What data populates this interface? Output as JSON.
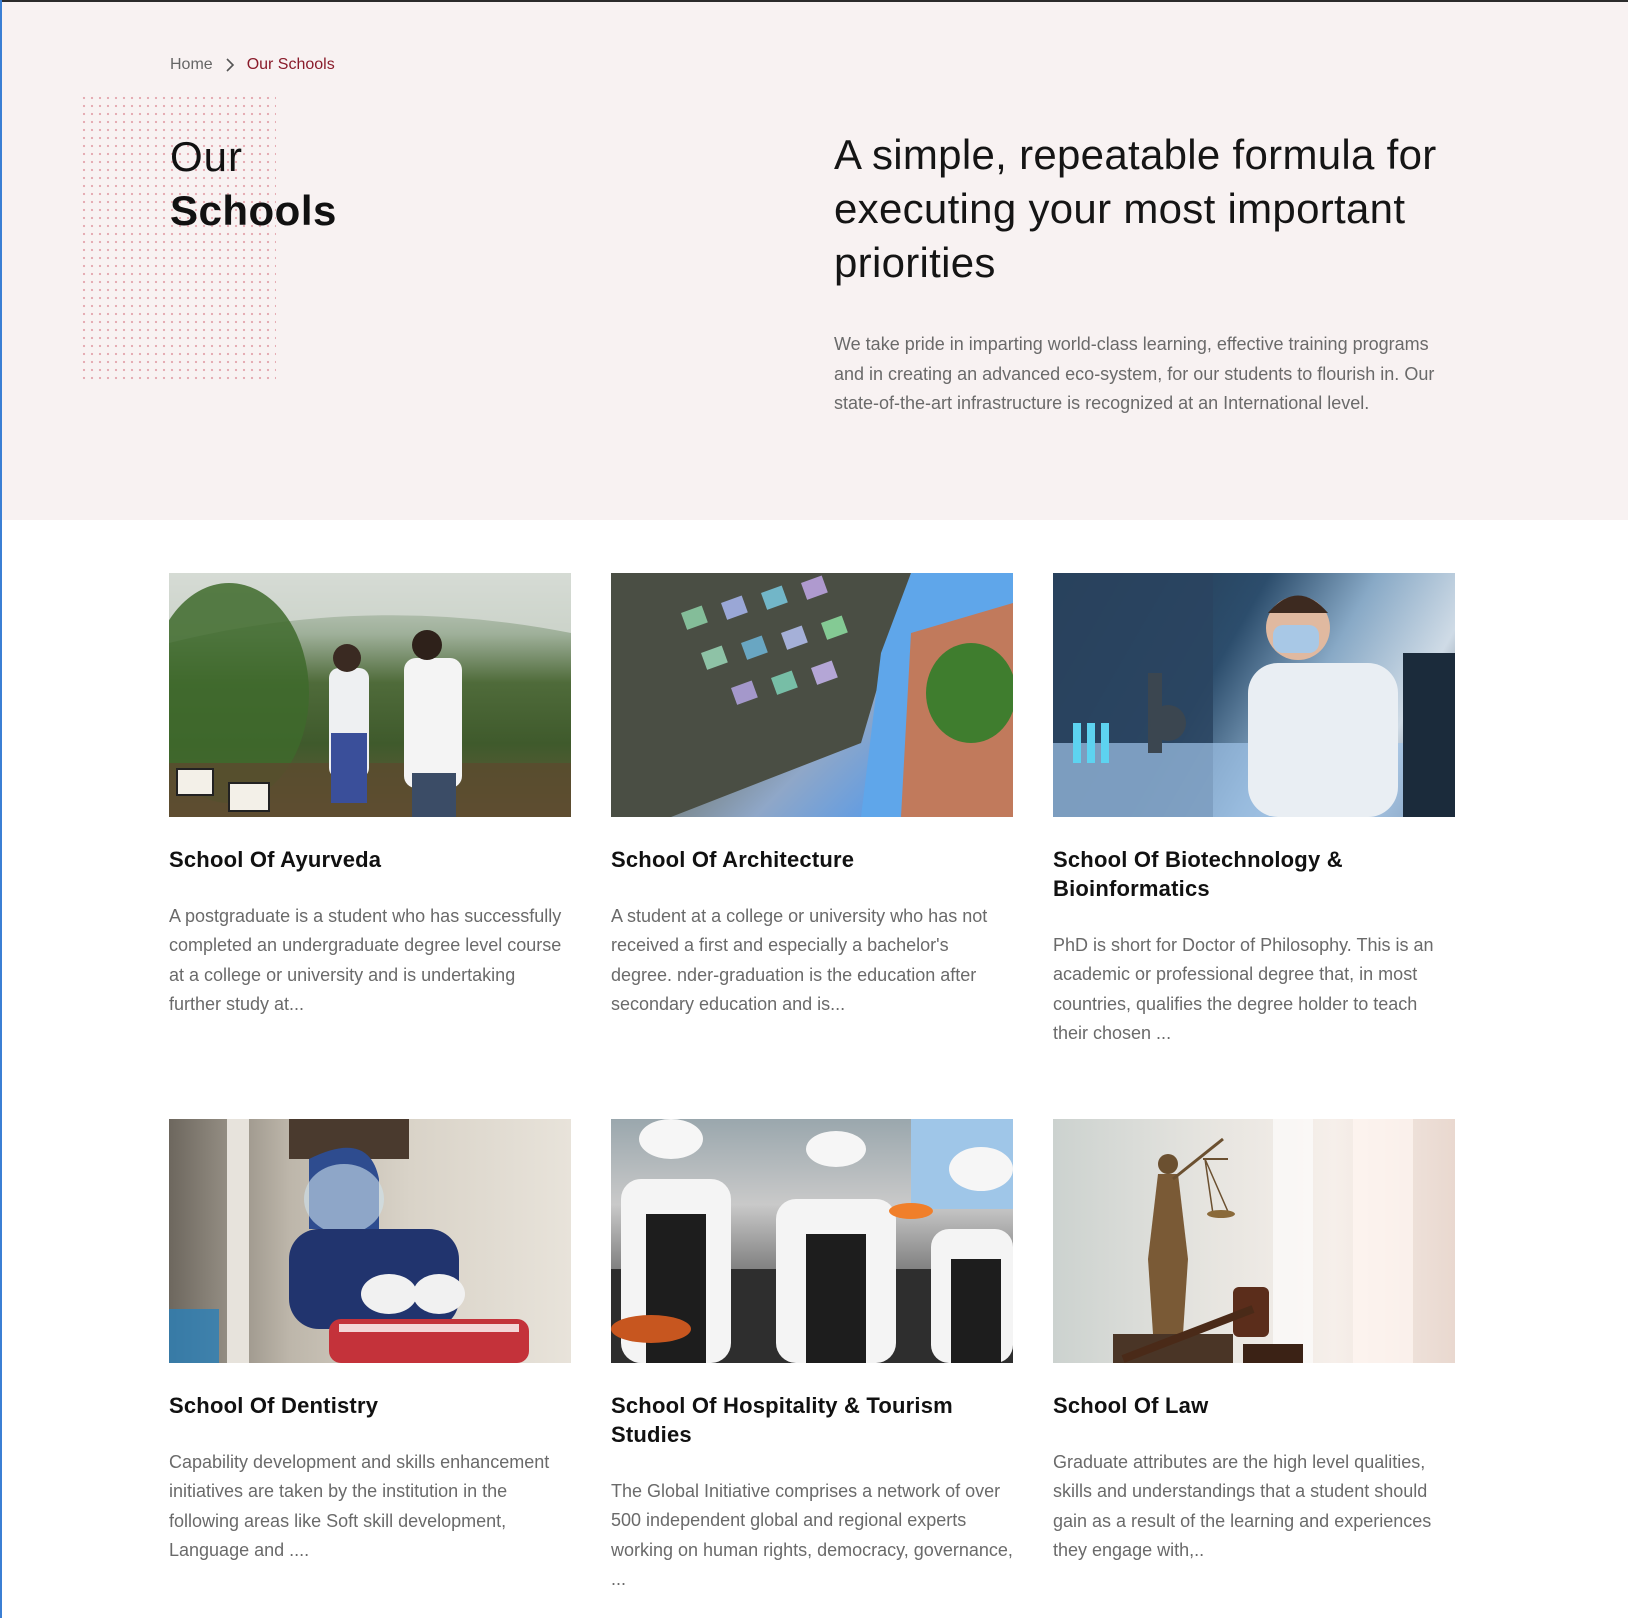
{
  "breadcrumb": {
    "home": "Home",
    "current": "Our Schools"
  },
  "hero": {
    "title_line1": "Our",
    "title_line2": "Schools",
    "heading": "A simple, repeatable formula for executing your most important priorities",
    "description": "We take pride in imparting world-class learning, effective training programs and in creating an advanced eco-system, for our students to flourish in. Our state-of-the-art infrastructure is recognized at an International level."
  },
  "schools": [
    {
      "title": "School Of Ayurveda",
      "description": "A postgraduate is a student who has successfully completed an undergraduate degree level course at a college or university and is undertaking further study at...",
      "image": "ayurveda-garden-photo"
    },
    {
      "title": "School Of Architecture",
      "description": "A student at a college or university who has not received a first and especially a bachelor's degree. nder-graduation is the education after secondary education and is...",
      "image": "architecture-building-photo"
    },
    {
      "title": "School Of Biotechnology & Bioinformatics",
      "description": "PhD is short for Doctor of Philosophy. This is an academic or professional degree that, in most countries, qualifies the degree holder to teach their chosen ...",
      "image": "biotech-lab-photo"
    },
    {
      "title": "School Of Dentistry",
      "description": "Capability development and skills enhancement initiatives are taken by the institution in the following areas like Soft skill development, Language and ....",
      "image": "dentistry-clinic-photo"
    },
    {
      "title": "School Of Hospitality & Tourism Studies",
      "description": "The Global Initiative comprises a network of over 500 independent global and regional experts working on human rights, democracy, governance, ...",
      "image": "hospitality-chefs-photo"
    },
    {
      "title": "School Of Law",
      "description": "Graduate attributes are the high level qualities, skills and understandings that a student should gain as a result of the learning and experiences they engage with,..",
      "image": "law-justice-statue-photo"
    }
  ],
  "colors": {
    "hero_bg": "#f8f2f2",
    "accent": "#8a1c2b",
    "dot_pattern": "#e3a5ad",
    "body_text": "#6a6a6a"
  },
  "icons": {
    "breadcrumb_separator": "chevron-right-icon"
  }
}
